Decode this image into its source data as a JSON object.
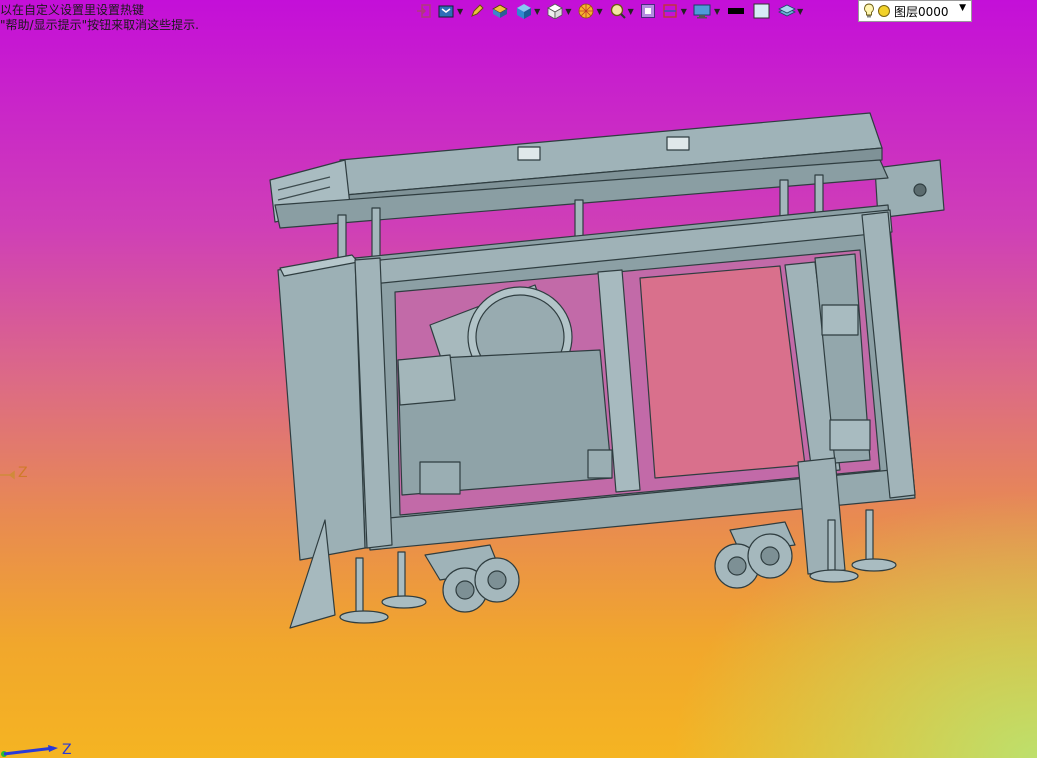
{
  "hints": {
    "line1": "以在自定义设置里设置热键",
    "line2": "\"帮助/显示提示\"按钮来取消这些提示."
  },
  "toolbar": {
    "icons": [
      "exit-icon",
      "view-orientation-icon",
      "pencil-icon",
      "box-layers-icon",
      "solid-cube-icon",
      "wire-cube-icon",
      "render-icon",
      "zoom-icon",
      "frame-icon",
      "section-icon",
      "display-icon",
      "color-swatch-black",
      "color-swatch-white",
      "layer-stack-icon"
    ]
  },
  "layer": {
    "name": "图层0000"
  },
  "axes": {
    "triad_left_label": "Z",
    "triad_bottom_label": "Z"
  },
  "colors": {
    "background_top": "#c40fd8",
    "background_bottom": "#f5b422",
    "model_fill": "#8fa3a8",
    "model_edge": "#2f3d40"
  }
}
